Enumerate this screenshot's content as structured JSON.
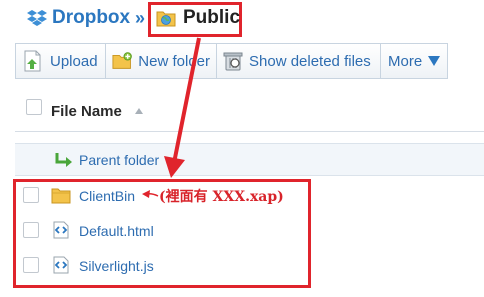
{
  "header": {
    "app_name": "Dropbox",
    "separator": "»",
    "current_folder": "Public"
  },
  "toolbar": {
    "upload_label": "Upload",
    "new_folder_label": "New folder",
    "show_deleted_label": "Show deleted files",
    "more_label": "More"
  },
  "columns": {
    "file_name": "File Name"
  },
  "parent_folder": {
    "label": "Parent folder"
  },
  "files": [
    {
      "name": "ClientBin",
      "type": "folder"
    },
    {
      "name": "Default.html",
      "type": "code-file"
    },
    {
      "name": "Silverlight.js",
      "type": "code-file"
    }
  ],
  "annotation": {
    "text": "(裡面有 XXX.xap)",
    "color": "#e0242c"
  },
  "colors": {
    "link": "#2d6cb0",
    "brand": "#2b77c0",
    "highlight": "#e0242c"
  }
}
